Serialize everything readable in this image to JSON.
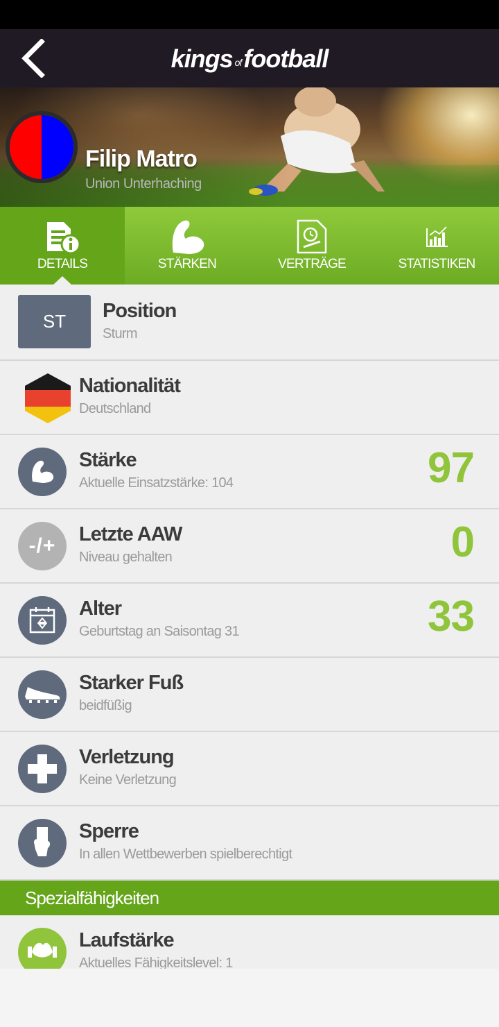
{
  "header": {
    "logo_part1": "kings",
    "logo_part2": "of",
    "logo_part3": "football"
  },
  "player": {
    "name": "Filip Matro",
    "club": "Union Unterhaching",
    "club_colors": [
      "#ff0000",
      "#0000ff"
    ]
  },
  "tabs": [
    {
      "label": "DETAILS",
      "icon": "document-info-icon",
      "active": true
    },
    {
      "label": "STÄRKEN",
      "icon": "flexed-arm-icon",
      "active": false
    },
    {
      "label": "VERTRÄGE",
      "icon": "contract-icon",
      "active": false
    },
    {
      "label": "STATISTIKEN",
      "icon": "bar-chart-icon",
      "active": false
    }
  ],
  "details": {
    "position": {
      "badge": "ST",
      "title": "Position",
      "sub": "Sturm"
    },
    "nationality": {
      "title": "Nationalität",
      "sub": "Deutschland",
      "flag_colors": [
        "#1a1a1a",
        "#e8412d",
        "#f2c20f"
      ]
    },
    "strength": {
      "title": "Stärke",
      "sub": "Aktuelle Einsatzstärke: 104",
      "value": "97"
    },
    "last_aaw": {
      "icon_text": "-/+",
      "title": "Letzte AAW",
      "sub": "Niveau gehalten",
      "value": "0"
    },
    "age": {
      "title": "Alter",
      "sub": "Geburtstag an Saisontag 31",
      "value": "33"
    },
    "foot": {
      "title": "Starker Fuß",
      "sub": "beidfüßig"
    },
    "injury": {
      "title": "Verletzung",
      "sub": "Keine Verletzung"
    },
    "ban": {
      "title": "Sperre",
      "sub": "In allen Wettbewerben spielberechtigt"
    }
  },
  "special": {
    "header": "Spezialfähigkeiten",
    "items": [
      {
        "title": "Laufstärke",
        "sub": "Aktuelles Fähigkeitslevel: 1"
      }
    ]
  },
  "colors": {
    "accent_green": "#8fc43b",
    "tab_green": "#64a51a",
    "icon_slate": "#5f6a7d",
    "header_dark": "#1f1a24"
  }
}
